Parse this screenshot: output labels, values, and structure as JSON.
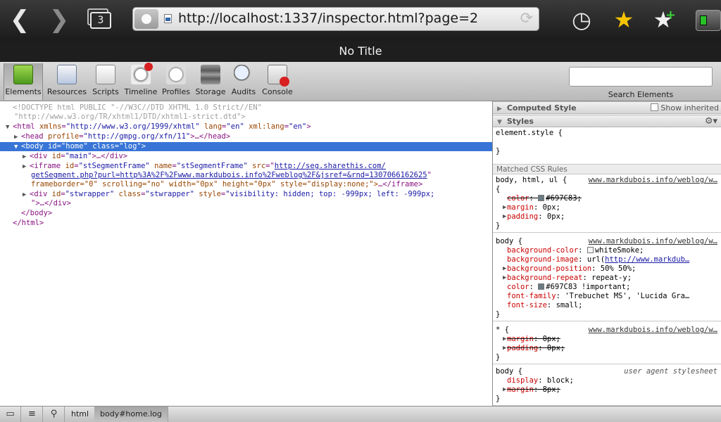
{
  "browser": {
    "tab_count": "3",
    "url": "http://localhost:1337/inspector.html?page=2",
    "page_title": "No Title"
  },
  "toolbar": {
    "tools": [
      {
        "label": "Elements"
      },
      {
        "label": "Resources"
      },
      {
        "label": "Scripts"
      },
      {
        "label": "Timeline"
      },
      {
        "label": "Profiles"
      },
      {
        "label": "Storage"
      },
      {
        "label": "Audits"
      },
      {
        "label": "Console"
      }
    ],
    "search_label": "Search Elements",
    "search_value": ""
  },
  "dom": {
    "doctype1": "<!DOCTYPE html PUBLIC \"-//W3C//DTD XHTML 1.0 Strict//EN\"",
    "doctype2": "\"http://www.w3.org/TR/xhtml1/DTD/xhtml1-strict.dtd\">",
    "html_xmlns": "\"http://www.w3.org/1999/xhtml\"",
    "html_lang": "\"en\"",
    "html_xmllang": "\"en\"",
    "head_profile": "\"http://gmpg.org/xfn/11\"",
    "body_id": "\"home\"",
    "body_class": "\"log\"",
    "div_main_id": "\"main\"",
    "iframe_id": "\"stSegmentFrame\"",
    "iframe_name": "\"stSegmentFrame\"",
    "iframe_src1": "http://seg.sharethis.com/",
    "iframe_src2": "getSegment.php?purl=http%3A%2F%2Fwww.markdubois.info%2Fweblog%2F&jsref=&rnd=1307066162625",
    "iframe_attrs_line": "frameborder=\"0\" scrolling=\"no\" width=\"0px\" height=\"0px\" style=\"display:none;\">",
    "stwrapper_id": "\"stwrapper\"",
    "stwrapper_class": "\"stwrapper\"",
    "stwrapper_style": "\"visibility: hidden; top: -999px; left: -999px;",
    "stwrapper_close": "\">…</div>"
  },
  "sidebar": {
    "computed_style": "Computed Style",
    "show_inherited": "Show inherited",
    "styles": "Styles",
    "element_style": "element.style {",
    "close_brace": "}",
    "matched_rules": "Matched CSS Rules",
    "rules": [
      {
        "selector": "body, html, ul {",
        "source": "www.markdubois.info/weblog/w…",
        "props": [
          {
            "name": "color",
            "value": "#697C83;",
            "swatch": "#697C83",
            "struck": true,
            "expandable": false
          },
          {
            "name": "margin",
            "value": "0px;",
            "struck": false,
            "expandable": true
          },
          {
            "name": "padding",
            "value": "0px;",
            "struck": false,
            "expandable": true
          }
        ]
      },
      {
        "selector": "body {",
        "source": "www.markdubois.info/weblog/w…",
        "props": [
          {
            "name": "background-color",
            "value": "whiteSmoke;",
            "swatch": "#F5F5F5",
            "struck": false,
            "expandable": false
          },
          {
            "name": "background-image",
            "value": "url(",
            "link": "http://www.markdub…",
            "struck": false,
            "expandable": false
          },
          {
            "name": "background-position",
            "value": "50% 50%;",
            "struck": false,
            "expandable": true
          },
          {
            "name": "background-repeat",
            "value": "repeat-y;",
            "struck": false,
            "expandable": true
          },
          {
            "name": "color",
            "value": "#697C83 !important;",
            "swatch": "#697C83",
            "struck": false,
            "expandable": false
          },
          {
            "name": "font-family",
            "value": "'Trebuchet MS', 'Lucida Gra…",
            "struck": false,
            "expandable": false
          },
          {
            "name": "font-size",
            "value": "small;",
            "struck": false,
            "expandable": false
          }
        ]
      },
      {
        "selector": "* {",
        "source": "www.markdubois.info/weblog/w…",
        "props": [
          {
            "name": "margin",
            "value": "0px;",
            "struck": true,
            "expandable": true
          },
          {
            "name": "padding",
            "value": "0px;",
            "struck": true,
            "expandable": true
          }
        ]
      },
      {
        "selector": "body {",
        "source": "user agent stylesheet",
        "props": [
          {
            "name": "display",
            "value": "block;",
            "struck": false,
            "expandable": false
          },
          {
            "name": "margin",
            "value": "8px;",
            "struck": true,
            "expandable": true
          }
        ]
      }
    ]
  },
  "status_bar": {
    "crumbs": [
      "html",
      "body#home.log"
    ]
  },
  "colors": {
    "selection": "#3875d7",
    "tag": "#881280",
    "attr": "#994500",
    "value": "#1a1aa6",
    "css_prop": "#c80000"
  }
}
